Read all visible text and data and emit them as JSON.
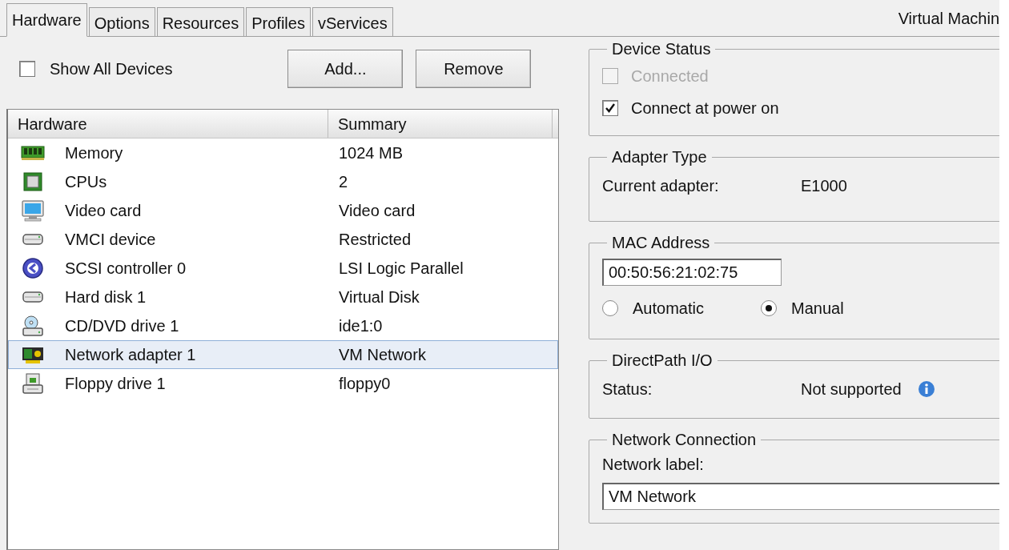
{
  "tabs": [
    {
      "label": "Hardware",
      "selected": true
    },
    {
      "label": "Options",
      "selected": false
    },
    {
      "label": "Resources",
      "selected": false
    },
    {
      "label": "Profiles",
      "selected": false
    },
    {
      "label": "vServices",
      "selected": false
    }
  ],
  "header_title": "Virtual Machin",
  "show_all_devices": {
    "label": "Show All Devices",
    "checked": false
  },
  "buttons": [
    "Add...",
    "Remove"
  ],
  "table": {
    "columns": [
      "Hardware",
      "Summary"
    ],
    "rows": [
      {
        "kind": "memory",
        "name": "Memory",
        "summary": "1024 MB",
        "selected": false
      },
      {
        "kind": "cpu",
        "name": "CPUs",
        "summary": "2",
        "selected": false
      },
      {
        "kind": "video",
        "name": "Video card",
        "summary": "Video card",
        "selected": false
      },
      {
        "kind": "drive",
        "name": "VMCI device",
        "summary": "Restricted",
        "selected": false
      },
      {
        "kind": "controller",
        "name": "SCSI controller 0",
        "summary": "LSI Logic Parallel",
        "selected": false
      },
      {
        "kind": "drive",
        "name": "Hard disk 1",
        "summary": "Virtual Disk",
        "selected": false
      },
      {
        "kind": "cdrom",
        "name": "CD/DVD drive 1",
        "summary": "ide1:0",
        "selected": false
      },
      {
        "kind": "network",
        "name": "Network adapter 1",
        "summary": "VM Network",
        "selected": true
      },
      {
        "kind": "floppy",
        "name": "Floppy drive 1",
        "summary": "floppy0",
        "selected": false
      }
    ]
  },
  "device_status": {
    "title": "Device Status",
    "options": [
      {
        "label": "Connected",
        "checked": false,
        "disabled": true
      },
      {
        "label": "Connect at power on",
        "checked": true,
        "disabled": false
      }
    ]
  },
  "adapter_type": {
    "title": "Adapter Type",
    "label": "Current adapter:",
    "value": "E1000"
  },
  "mac_address": {
    "title": "MAC Address",
    "value": "00:50:56:21:02:75",
    "options": [
      {
        "label": "Automatic",
        "selected": false
      },
      {
        "label": "Manual",
        "selected": true
      }
    ]
  },
  "directpath_io": {
    "title": "DirectPath I/O",
    "label": "Status:",
    "value": "Not supported"
  },
  "network_connection": {
    "title": "Network Connection",
    "label": "Network label:",
    "value": "VM Network"
  }
}
